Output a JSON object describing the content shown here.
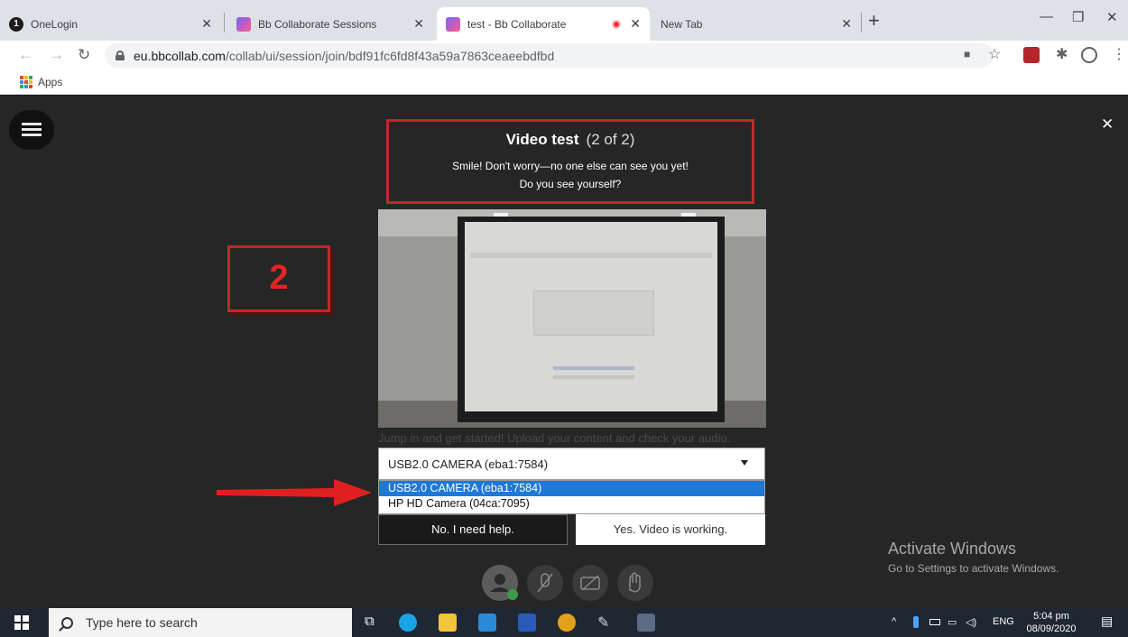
{
  "browser": {
    "tabs": [
      {
        "label": "OneLogin",
        "favicon": "onelogin-icon",
        "active": false
      },
      {
        "label": "Bb Collaborate Sessions",
        "favicon": "collaborate-icon",
        "active": false
      },
      {
        "label": "test - Bb Collaborate",
        "favicon": "collaborate-icon",
        "active": true,
        "recording": true
      },
      {
        "label": "New Tab",
        "favicon": "",
        "active": false
      }
    ],
    "new_tab_icon": "plus-icon",
    "window_controls": [
      "minimize-icon",
      "restore-icon",
      "close-icon"
    ],
    "url_domain": "eu.bbcollab.com",
    "url_path": "/collab/ui/session/join/bdf91fc6fd8f43a59a7863ceaeebdfbd",
    "bookmarks": [
      {
        "label": "Apps",
        "icon": "apps-grid-icon"
      }
    ]
  },
  "dialog": {
    "title": "Video test",
    "step": "(2 of 2)",
    "line1": "Smile! Don't worry—no one else can see you yet!",
    "line2": "Do you see yourself?",
    "annotation_number": "2",
    "background_text": "Jump in and get started! Upload your content and check your audio.",
    "camera_select": {
      "selected": "USB2.0 CAMERA (eba1:7584)",
      "options": [
        "USB2.0 CAMERA (eba1:7584)",
        "HP HD Camera (04ca:7095)"
      ],
      "highlighted_index": 0
    },
    "no_button": "No. I need help.",
    "yes_button": "Yes. Video is working."
  },
  "watermark": {
    "title": "Activate Windows",
    "subtitle": "Go to Settings to activate Windows."
  },
  "taskbar": {
    "search_placeholder": "Type here to search",
    "language": "ENG",
    "time": "5:04 pm",
    "date": "08/09/2020"
  },
  "colors": {
    "annotation_red": "#c0292b",
    "selection_blue": "#1e78d8",
    "app_background": "#262626"
  }
}
